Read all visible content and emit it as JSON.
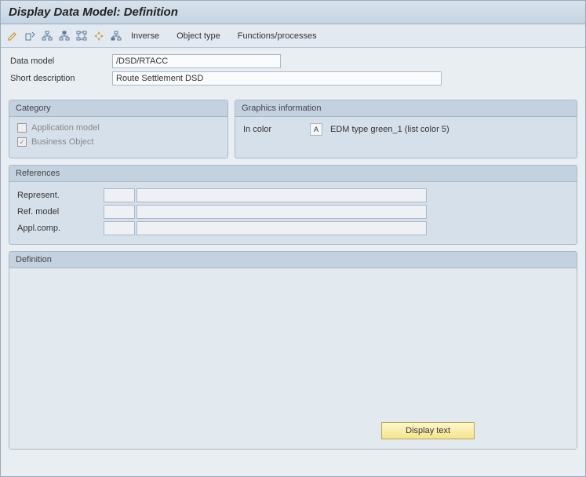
{
  "title": "Display Data Model: Definition",
  "toolbar": {
    "inverse_label": "Inverse",
    "object_type_label": "Object type",
    "functions_label": "Functions/processes"
  },
  "fields": {
    "data_model_label": "Data model",
    "data_model_value": "/DSD/RTACC",
    "short_desc_label": "Short description",
    "short_desc_value": "Route Settlement DSD"
  },
  "category": {
    "title": "Category",
    "application_model_label": "Application model",
    "application_model_checked": false,
    "business_object_label": "Business Object",
    "business_object_checked": true
  },
  "graphics": {
    "title": "Graphics information",
    "in_color_label": "In color",
    "box_text": "A",
    "edm_text": "EDM type green_1 (list color 5)"
  },
  "references": {
    "title": "References",
    "represent_label": "Represent.",
    "ref_model_label": "Ref. model",
    "appl_comp_label": "Appl.comp."
  },
  "definition": {
    "title": "Definition",
    "display_text_btn": "Display text"
  }
}
